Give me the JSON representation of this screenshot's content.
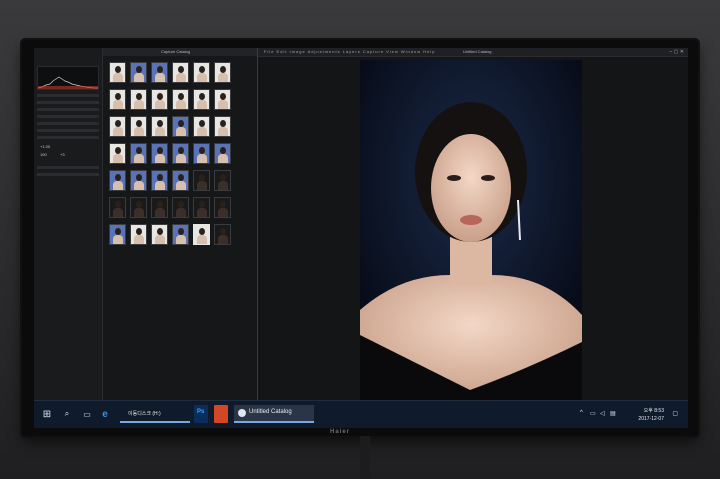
{
  "app": {
    "viewer_menu": "File Edit Image Adjustments Layers Capture View Window Help",
    "browser_title": "Capture Catalog",
    "viewer_title": "Untitled Catalog"
  },
  "taskbar": {
    "drive_label": "이동디스크 (H:)",
    "catalog_label": "Untitled Catalog",
    "clock_time": "오후 8:53",
    "clock_date": "2017-12-07",
    "notification_count": "14"
  },
  "left_panel": {
    "exposure_value": "+1.00",
    "iso_value": "100",
    "contrast_value": "+3",
    "sections": [
      "Exposure Evaluation",
      "Base Characteristics",
      "Lens Correction",
      "White Balance",
      "Exposure",
      "High Dynamic Range",
      "Clarity",
      "Vignetting"
    ]
  },
  "brand": "Haier",
  "colors": {
    "taskbar": "#0f1a2b",
    "accent": "#78a6e0",
    "photo_bg": "#0c1426",
    "thumb_blue": "#5a73b6"
  },
  "icons": {
    "start": "windows-start-icon",
    "search": "search-icon",
    "taskview": "task-view-icon",
    "edge": "edge-browser-icon",
    "explorer": "file-explorer-icon",
    "photoshop": "photoshop-icon",
    "office": "office-icon",
    "capture_one": "capture-one-icon"
  }
}
